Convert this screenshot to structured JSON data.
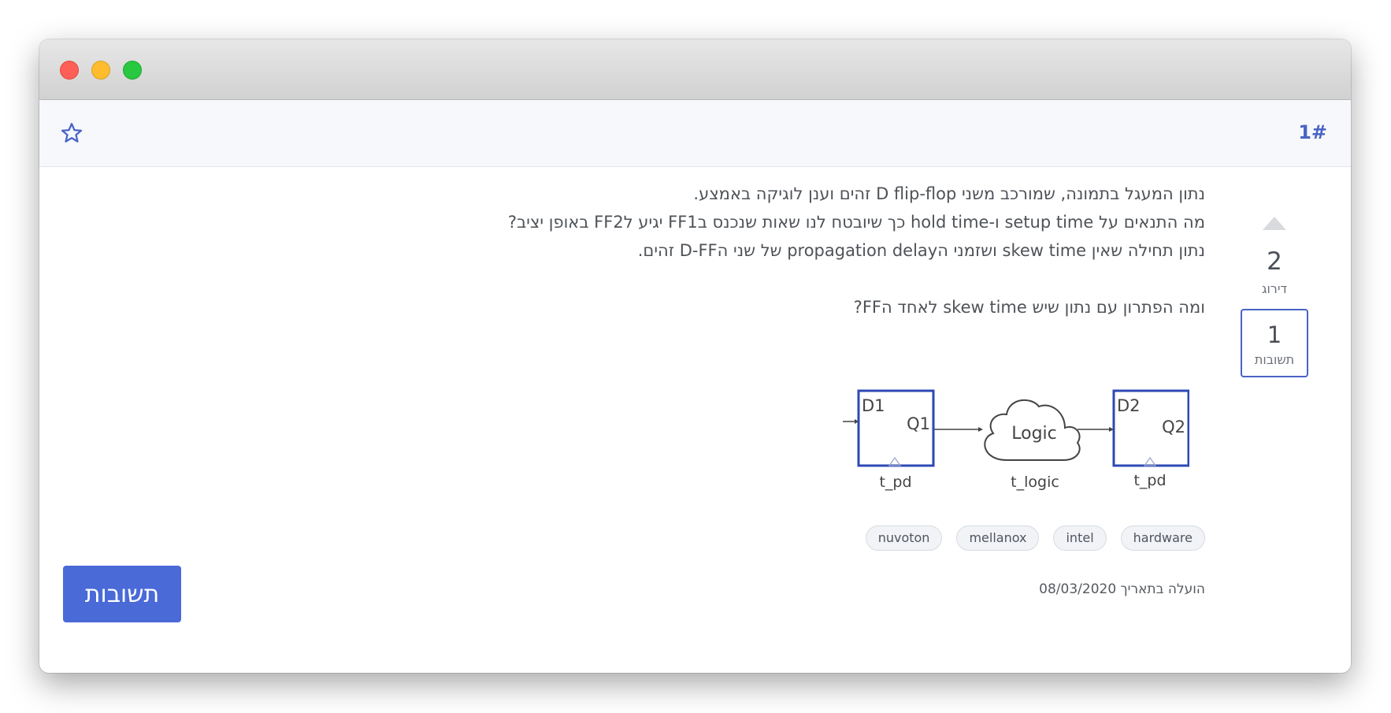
{
  "header": {
    "question_number": "1#"
  },
  "sidebar": {
    "score": "2",
    "score_label": "דירוג",
    "answers_count": "1",
    "answers_label": "תשובות"
  },
  "question": {
    "lines": [
      "נתון המעגל בתמונה, שמורכב משני D flip-flop זהים וענן לוגיקה באמצע.",
      "מה התנאים על setup time ו-hold time כך שיובטח לנו שאות שנכנס בFF1 יגיע לFF2 באופן יציב?",
      "נתון תחילה שאין skew time ושזמני הpropagation delay של שני הD-FF זהים.",
      "ומה הפתרון עם נתון שיש skew time לאחד הFF?"
    ]
  },
  "diagram": {
    "ff1_d": "D1",
    "ff1_q": "Q1",
    "ff1_label": "t_pd",
    "cloud_text": "Logic",
    "cloud_label": "t_logic",
    "ff2_d": "D2",
    "ff2_q": "Q2",
    "ff2_label": "t_pd"
  },
  "tags": [
    "hardware",
    "intel",
    "mellanox",
    "nuvoton"
  ],
  "footer": {
    "date_text": "הועלה בתאריך 08/03/2020",
    "answers_button": "תשובות"
  },
  "colors": {
    "accent": "#4a63c4",
    "button": "#4a6ad8",
    "ff_border": "#2d48b5"
  }
}
